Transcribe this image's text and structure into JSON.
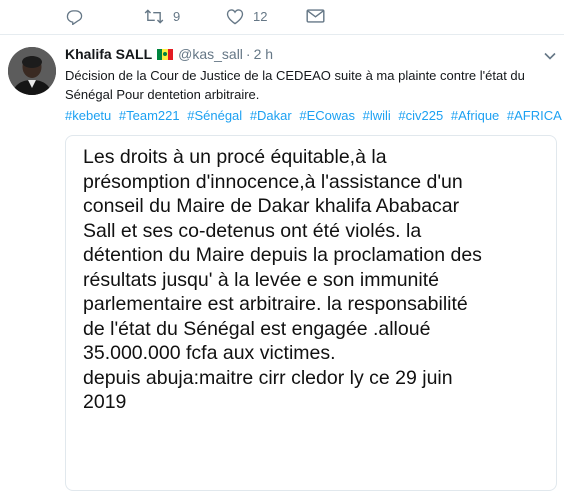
{
  "prev_tweet_actions": {
    "reply_count": "",
    "retweet_count": "9",
    "like_count": "12"
  },
  "tweet": {
    "author_name": "Khalifa SALL",
    "handle": "@kas_sall",
    "separator": "·",
    "time": "2 h",
    "text": "Décision de la Cour de Justice de la CEDEAO suite à ma plainte contre l'état du Sénégal Pour dentetion arbitraire.",
    "hashtags": [
      "#kebetu",
      "#Team221",
      "#Sénégal",
      "#Dakar",
      "#ECowas",
      "#lwili",
      "#civ225",
      "#Afrique",
      "#AFRICA"
    ],
    "media_text": "Les droits à un procé équitable,à la\nprésomption d'innocence,à l'assistance d'un\nconseil du Maire de Dakar khalifa Ababacar\nSall et ses co-detenus ont été violés. la\ndétention du Maire depuis la proclamation des\nrésultats jusqu' à la levée e son immunité\nparlementaire est arbitraire. la responsabilité\nde l'état du Sénégal est engagée .alloué\n35.000.000 fcfa aux victimes.\ndepuis abuja:maitre cirr cledor ly ce 29 juin\n2019"
  },
  "colors": {
    "link": "#1da1f2",
    "muted": "#657786",
    "border": "#e6ecf0"
  }
}
